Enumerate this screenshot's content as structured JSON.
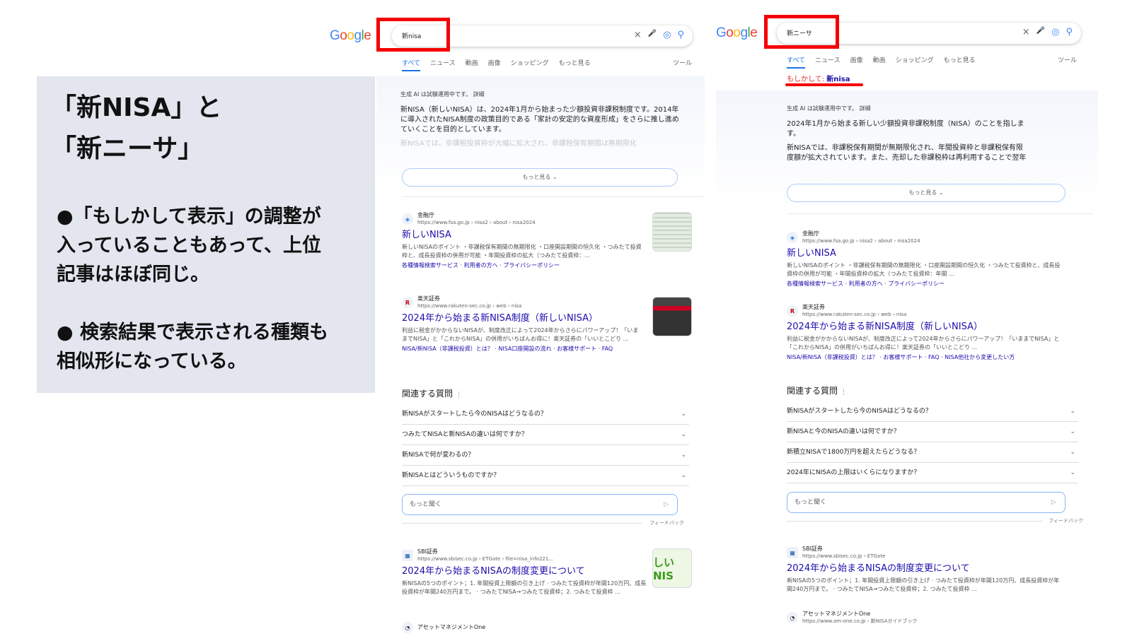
{
  "panel": {
    "title": "「新NISA」と\n「新ニーサ」",
    "bullet1": "●「もしかして表示」の調整が\n 入っていることもあって、上位\n 記事はほぼ同じ。",
    "bullet2": "● 検索結果で表示される種類も\n 相似形になっている。"
  },
  "colors": {
    "highlight": "#f40000",
    "panel": "#e3e6ef",
    "link": "#1a0dab"
  },
  "left": {
    "logo": "Google",
    "query": "新nisa",
    "icons": {
      "clear": "×",
      "mic": "🎤",
      "lens": "◎",
      "search": "⚲"
    },
    "tabs": [
      "すべて",
      "ニュース",
      "動画",
      "画像",
      "ショッピング",
      "もっと見る"
    ],
    "tools": "ツール",
    "ai_label": "生成 AI は試験運用中です。 詳細",
    "ai_text": "新NISA（新しいNISA）は、2024年1月から始まった少額投資非課税制度です。2014年に導入されたNISA制度の政策目的である「家計の安定的な資産形成」をさらに推し進めていくことを目的としています。",
    "ai_fade": "新NISAでは、非課税投資枠が大幅に拡大され、非課税保有期間は無期限化",
    "more": "もっと見る",
    "results": [
      {
        "site": "金融庁",
        "url": "https://www.fsa.go.jp › nisa2 › about › nisa2024",
        "title": "新しいNISA",
        "snippet": "新しいNISAのポイント ・非課税保有期間の無期限化 ・口座開設期間の恒久化 ・つみたて投資枠と、成長投資枠の併用が可能 ・年間投資枠の拡大（つみたて投資枠：...",
        "links": "各種情報検索サービス · 利用者の方へ · プライバシーポリシー"
      },
      {
        "site": "楽天証券",
        "url": "https://www.rakuten-sec.co.jp › web › nisa",
        "title": "2024年から始まる新NISA制度（新しいNISA）",
        "snippet": "利益に税金がかからないNISAが、制度改正によって2024年からさらにパワーアップ！「いままでNISA」と「これからNISA」の併用がいちばんお得に！楽天証券の「いいとこどり ...",
        "links": "NISA/新NISA（非課税投資）とは？ · NISA口座開設の流れ · お客様サポート · FAQ"
      }
    ],
    "paa_title": "関連する質問",
    "paa": [
      "新NISAがスタートしたら今のNISAはどうなるの？",
      "つみたてNISAと新NISAの違いは何ですか？",
      "新NISAで何が変わるの？",
      "新NISAとはどういうものですか？"
    ],
    "ask_placeholder": "もっと聞く",
    "feedback": "フィードバック",
    "results2": [
      {
        "site": "SBI証券",
        "url": "https://www.sbisec.co.jp › ETGate › file=nisa_info221...",
        "title": "2024年から始まるNISAの制度変更について",
        "snippet": "新NISAの5つのポイント；1. 年間投資上限額の引き上げ · つみたて投資枠が年間120万円、成長投資枠が年間240万円まで。 · つみたてNISA→つみたて投資枠；2. つみたて投資枠 ..."
      },
      {
        "site": "アセットマネジメントOne"
      }
    ],
    "thumb3_text": "しいNIS"
  },
  "right": {
    "logo": "Google",
    "query": "新ニーサ",
    "icons": {
      "clear": "×",
      "mic": "🎤",
      "lens": "◎",
      "search": "⚲"
    },
    "tabs": [
      "すべて",
      "ニュース",
      "画像",
      "動画",
      "ショッピング",
      "もっと見る"
    ],
    "tools": "ツール",
    "did_you_mean_prefix": "もしかして: ",
    "did_you_mean_term": "新nisa",
    "ai_label": "生成 AI は試験運用中です。 詳細",
    "ai_text": "2024年1月から始まる新しい少額投資非課税制度（NISA）のことを指します。",
    "ai_text2": "新NISAでは、非課税保有期間が無期限化され、年間投資枠と非課税保有限度額が拡大されています。また、売却した非課税枠は再利用することで翌年",
    "more": "もっと見る",
    "results": [
      {
        "site": "金融庁",
        "url": "https://www.fsa.go.jp › nisa2 › about › nisa2024",
        "title": "新しいNISA",
        "snippet": "新しいNISAのポイント ・非課税保有期間の無期限化 ・口座開設期間の恒久化 ・つみたて投資枠と、成長投資枠の併用が可能 ・年間投資枠の拡大（つみたて投資枠：年間 ...",
        "links": "各種情報検索サービス · 利用者の方へ · プライバシーポリシー"
      },
      {
        "site": "楽天証券",
        "url": "https://www.rakuten-sec.co.jp › web › nisa",
        "title": "2024年から始まる新NISA制度（新しいNISA）",
        "snippet": "利益に税金がかからないNISAが、制度改正によって2024年からさらにパワーアップ！「いままでNISA」と「これからNISA」の併用がいちばんお得に！楽天証券の「いいとこどり ...",
        "links": "NISA/新NISA（非課税投資）とは？ · お客様サポート · FAQ · NISA他社から変更したい方"
      }
    ],
    "paa_title": "関連する質問",
    "paa": [
      "新NISAがスタートしたら今のNISAはどうなるの？",
      "新NISAと今のNISAの違いは何ですか？",
      "新積立NISAで1800万円を超えたらどうなる？",
      "2024年にNISAの上限はいくらになりますか？"
    ],
    "ask_placeholder": "もっと聞く",
    "feedback": "フィードバック",
    "results2": [
      {
        "site": "SBI証券",
        "url": "https://www.sbisec.co.jp › ETGate",
        "title": "2024年から始まるNISAの制度変更について",
        "snippet": "新NISAの5つのポイント；1. 年間投資上限額の引き上げ · つみたて投資枠が年間120万円、成長投資枠が年間240万円まで。 · つみたてNISA→つみたて投資枠；2. つみたて投資枠 ..."
      },
      {
        "site": "アセットマネジメントOne",
        "url": "https://www.am-one.co.jp › 新NISAガイドブック"
      }
    ]
  }
}
